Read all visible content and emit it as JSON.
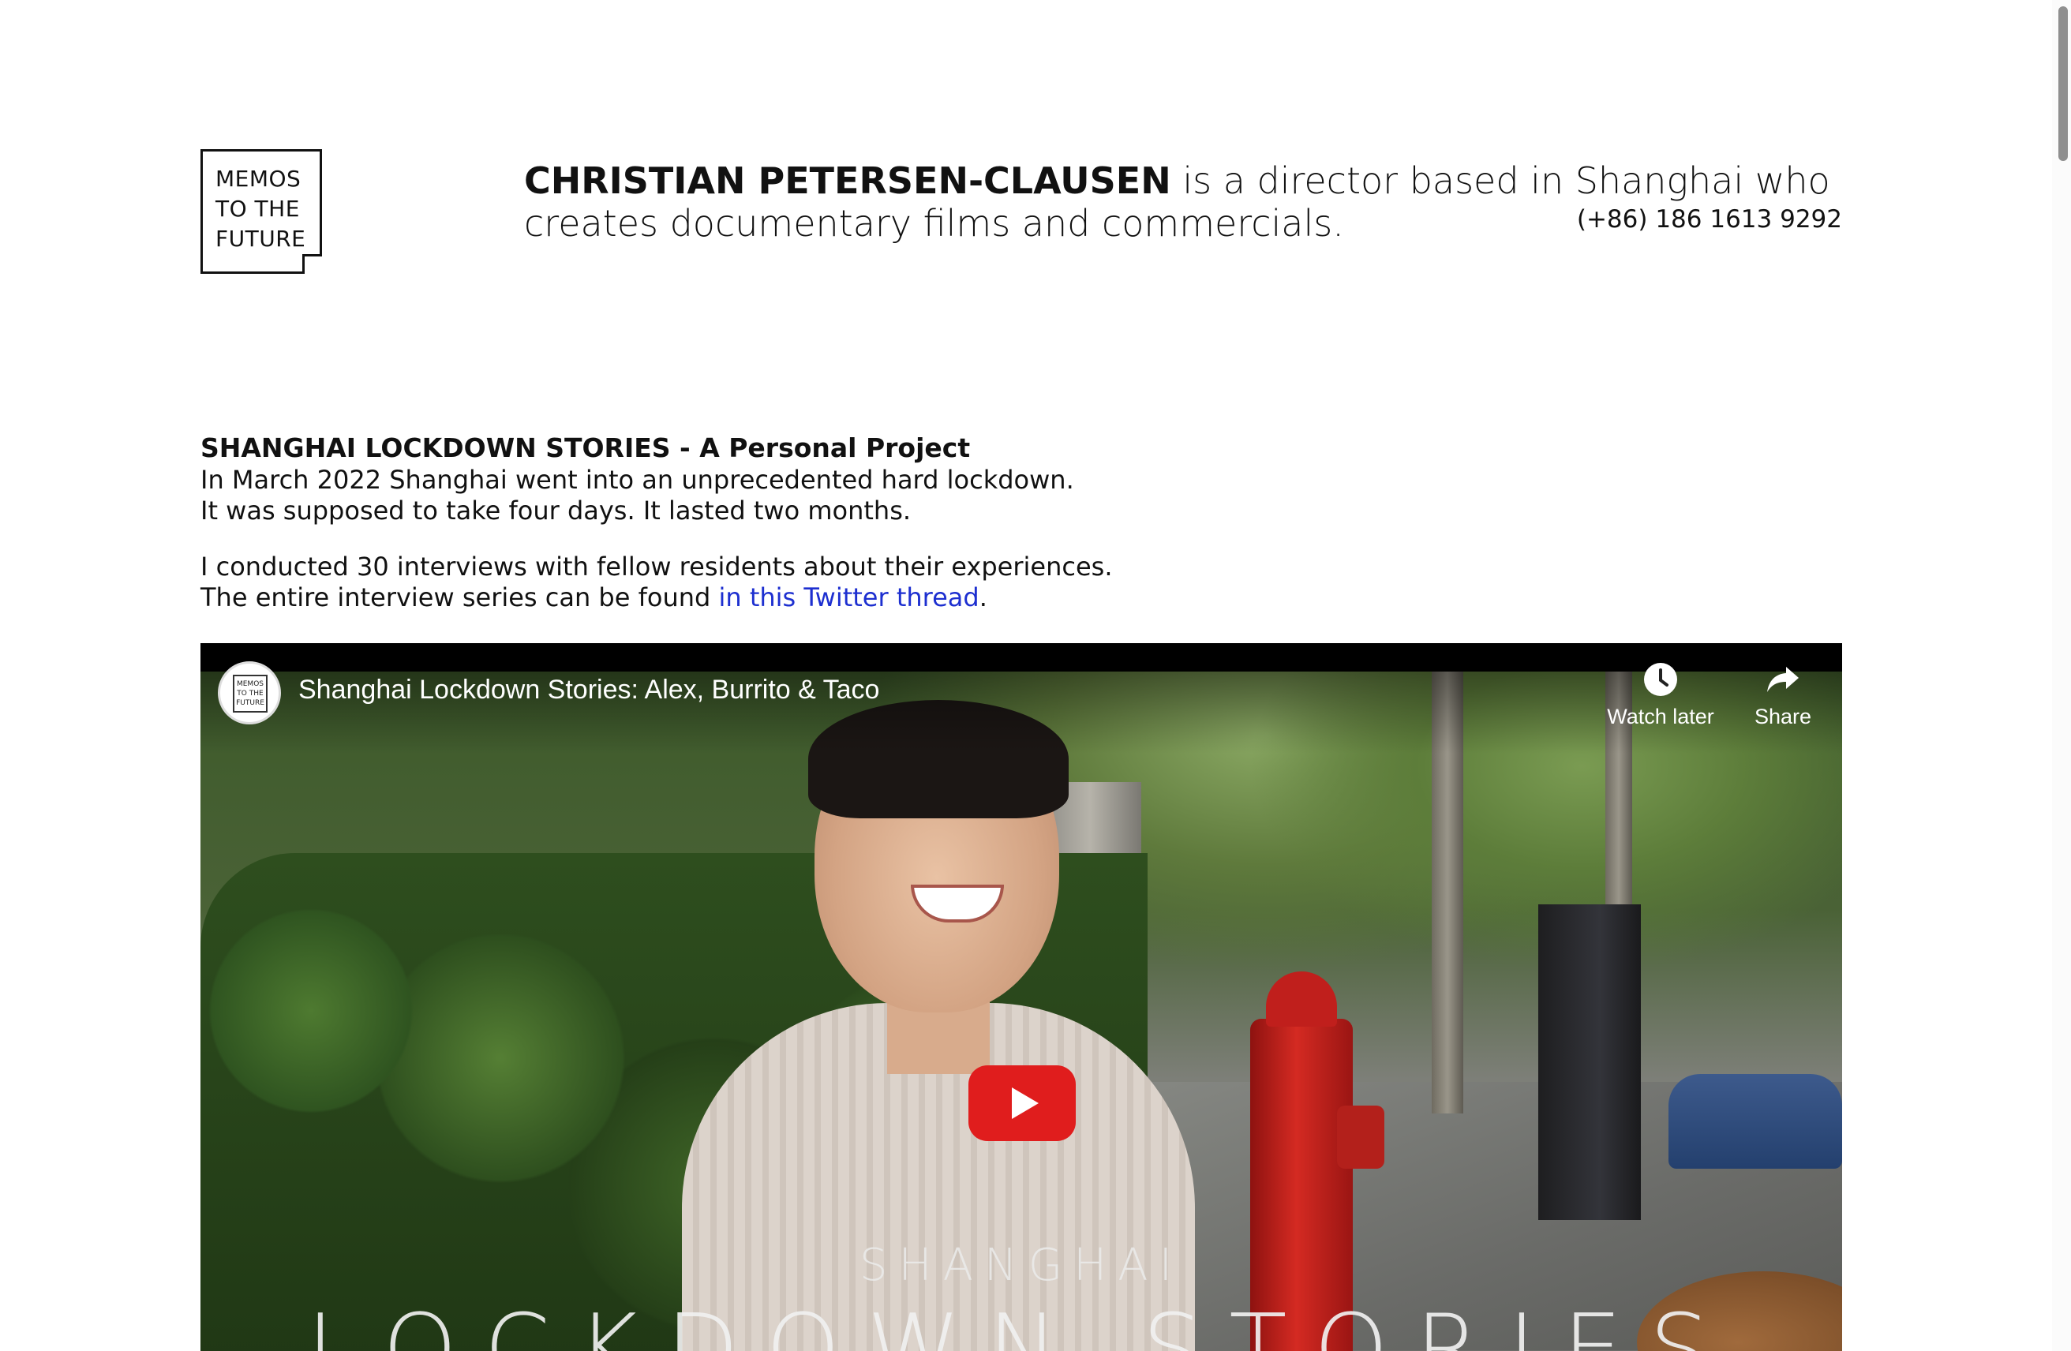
{
  "logo": {
    "lines": "MEMOS\nTO THE\nFUTURE"
  },
  "intro": {
    "name": "CHRISTIAN PETERSEN-CLAUSEN",
    "text": " is a director based in Shanghai who creates documentary films and commercials.",
    "phone": "(+86) 186 1613 9292"
  },
  "project": {
    "heading": "SHANGHAI LOCKDOWN STORIES - A Personal Project",
    "line1": "In March 2022 Shanghai went into an unprecedented hard lockdown.",
    "line2": "It was supposed to take four days. It lasted two months.",
    "line3": "I conducted 30 interviews with fellow residents about their experiences.",
    "line4_prefix": "The entire interview series can be found ",
    "link_text": "in this Twitter thread",
    "line4_suffix": "."
  },
  "video": {
    "channel_avatar_text": "MEMOS\nTO THE\nFUTURE",
    "title": "Shanghai Lockdown Stories: Alex, Burrito & Taco",
    "watch_later": "Watch later",
    "share": "Share",
    "overlay_small": "SHANGHAI",
    "overlay_large": "LOCKDOWN STORIES",
    "play_color": "#e01d1d"
  }
}
